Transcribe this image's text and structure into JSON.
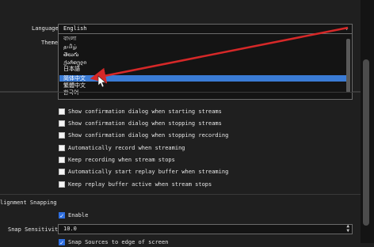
{
  "form": {
    "language_label": "Language",
    "language_value": "English",
    "theme_label": "Theme",
    "language_options": [
      "বাংলা",
      "தமிழ்",
      "తెలుగు",
      "ქართული",
      "日本語",
      "简体中文",
      "繁體中文",
      "한국어"
    ],
    "selected_option_index": 5
  },
  "checkboxes": [
    {
      "label": "Show confirmation dialog when starting streams",
      "checked": false
    },
    {
      "label": "Show confirmation dialog when stopping streams",
      "checked": false
    },
    {
      "label": "Show confirmation dialog when stopping recording",
      "checked": false
    },
    {
      "label": "Automatically record when streaming",
      "checked": false
    },
    {
      "label": "Keep recording when stream stops",
      "checked": false
    },
    {
      "label": "Automatically start replay buffer when streaming",
      "checked": false
    },
    {
      "label": "Keep replay buffer active when stream stops",
      "checked": false
    }
  ],
  "snapping": {
    "section_title": "lignment Snapping",
    "enable_label": "Enable",
    "enable_checked": true,
    "sensitivity_label": "Snap Sensitivity",
    "sensitivity_value": "10.0",
    "snap_sources_label": "Snap Sources to edge of screen"
  },
  "colors": {
    "accent": "#3a7bd5",
    "annotation_arrow": "#d62828"
  },
  "icons": {
    "dropdown": "chevron-down-icon",
    "cursor": "mouse-pointer-icon",
    "arrow": "red-arrow-annotation"
  }
}
